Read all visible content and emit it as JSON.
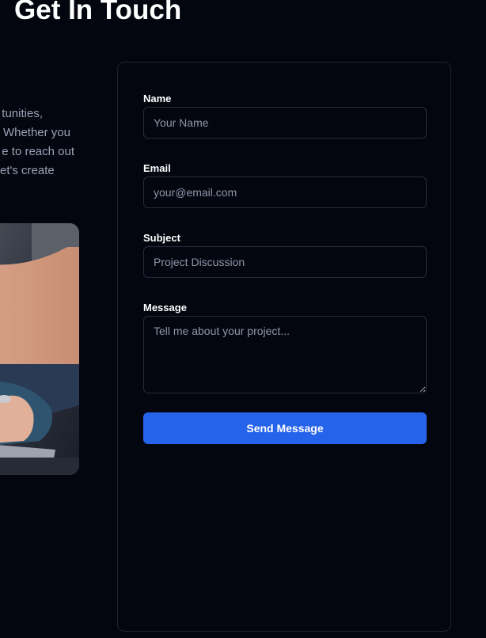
{
  "header": {
    "title": "Get In Touch"
  },
  "intro": {
    "lines": [
      "tunities,",
      "Whether you",
      "e to reach out",
      "et's create"
    ]
  },
  "form": {
    "name": {
      "label": "Name",
      "placeholder": "Your Name"
    },
    "email": {
      "label": "Email",
      "placeholder": "your@email.com"
    },
    "subject": {
      "label": "Subject",
      "placeholder": "Project Discussion"
    },
    "message": {
      "label": "Message",
      "placeholder": "Tell me about your project..."
    },
    "submit_label": "Send Message"
  },
  "colors": {
    "background": "#03050f",
    "accent": "#2563eb",
    "border": "#1f2433"
  }
}
